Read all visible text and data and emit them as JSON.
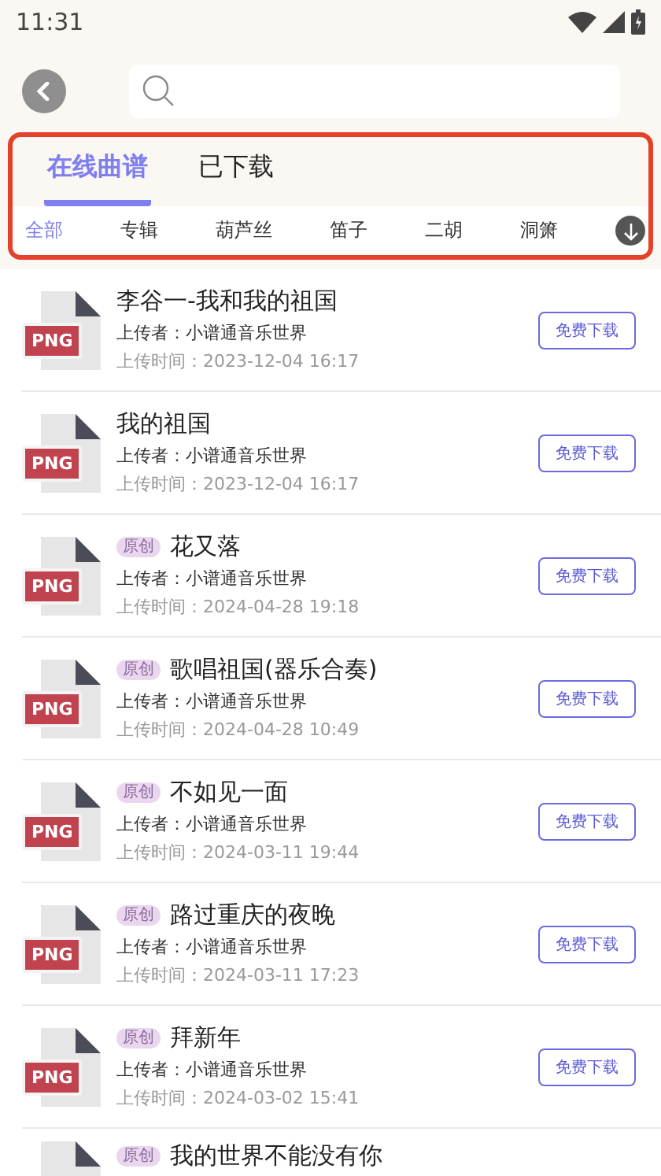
{
  "status_bar": {
    "time": "11:31"
  },
  "tabs": [
    {
      "label": "在线曲谱",
      "selected": true
    },
    {
      "label": "已下载",
      "selected": false
    }
  ],
  "categories": [
    {
      "label": "全部",
      "selected": true
    },
    {
      "label": "专辑",
      "selected": false
    },
    {
      "label": "葫芦丝",
      "selected": false
    },
    {
      "label": "笛子",
      "selected": false
    },
    {
      "label": "二胡",
      "selected": false
    },
    {
      "label": "洞箫",
      "selected": false
    }
  ],
  "scores": [
    {
      "file_type": "PNG",
      "title": "李谷一-我和我的祖国",
      "uploader": "上传者：小谱通音乐世界",
      "time": "上传时间：2023-12-04 16:17",
      "button": "免费下载"
    },
    {
      "file_type": "PNG",
      "title": "我的祖国",
      "uploader": "上传者：小谱通音乐世界",
      "time": "上传时间：2023-12-04 16:17",
      "button": "免费下载"
    },
    {
      "file_type": "PNG",
      "tag": "原创",
      "title": "花又落",
      "uploader": "上传者：小谱通音乐世界",
      "time": "上传时间：2024-04-28 19:18",
      "button": "免费下载"
    },
    {
      "file_type": "PNG",
      "tag": "原创",
      "title": "歌唱祖国(器乐合奏)",
      "uploader": "上传者：小谱通音乐世界",
      "time": "上传时间：2024-04-28 10:49",
      "button": "免费下载"
    },
    {
      "file_type": "PNG",
      "tag": "原创",
      "title": "不如见一面",
      "uploader": "上传者：小谱通音乐世界",
      "time": "上传时间：2024-03-11 19:44",
      "button": "免费下载"
    },
    {
      "file_type": "PNG",
      "tag": "原创",
      "title": "路过重庆的夜晚",
      "uploader": "上传者：小谱通音乐世界",
      "time": "上传时间：2024-03-11 17:23",
      "button": "免费下载"
    },
    {
      "file_type": "PNG",
      "tag": "原创",
      "title": "拜新年",
      "uploader": "上传者：小谱通音乐世界",
      "time": "上传时间：2024-03-02 15:41",
      "button": "免费下载"
    },
    {
      "tag": "原创",
      "title": "我的世界不能没有你"
    }
  ]
}
